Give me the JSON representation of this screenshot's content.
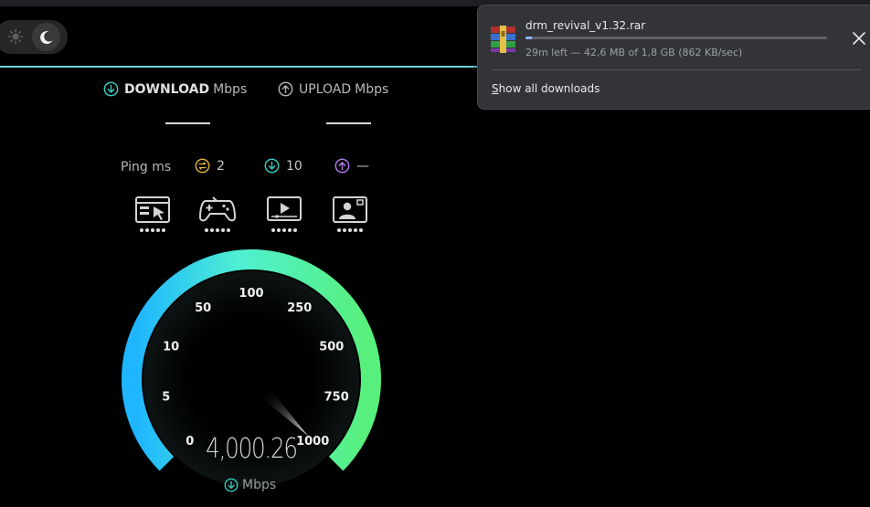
{
  "theme": {
    "sun_icon": "sun-icon",
    "moon_icon": "moon-icon",
    "active": "dark"
  },
  "modes": {
    "download": {
      "label": "DOWNLOAD",
      "unit": "Mbps"
    },
    "upload": {
      "label": "UPLOAD",
      "unit": "Mbps"
    }
  },
  "ping": {
    "label": "Ping ms",
    "idle": "2",
    "download": "10",
    "upload": "—"
  },
  "activities": [
    {
      "icon": "web-browsing-icon",
      "level": 5
    },
    {
      "icon": "gaming-icon",
      "level": 5
    },
    {
      "icon": "video-streaming-icon",
      "level": 5
    },
    {
      "icon": "video-chat-icon",
      "level": 5
    }
  ],
  "gauge": {
    "ticks": [
      "0",
      "5",
      "10",
      "50",
      "100",
      "250",
      "500",
      "750",
      "1000"
    ],
    "value": "4,000.26",
    "unit": "Mbps",
    "colors": {
      "start": "#1fb6ff",
      "mid": "#4ff0d2",
      "end": "#58f07c"
    }
  },
  "download": {
    "filename": "drm_revival_v1.32.rar",
    "progress_fraction": 0.02,
    "status": "29m left — 42,6 MB of 1,8 GB (862 KB/sec)",
    "show_all_label": "Show all downloads",
    "show_all_accesskey": "S",
    "show_all_rest": "how all downloads"
  }
}
